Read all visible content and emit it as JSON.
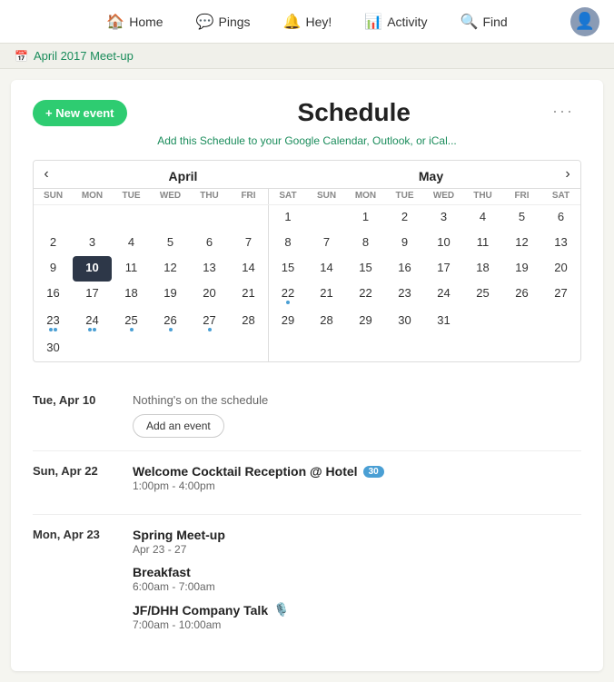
{
  "nav": {
    "items": [
      {
        "id": "home",
        "label": "Home",
        "icon": "🏠"
      },
      {
        "id": "pings",
        "label": "Pings",
        "icon": "💬"
      },
      {
        "id": "hey",
        "label": "Hey!",
        "icon": "🔔"
      },
      {
        "id": "activity",
        "label": "Activity",
        "icon": "📊"
      },
      {
        "id": "find",
        "label": "Find",
        "icon": "🔍"
      }
    ]
  },
  "breadcrumb": {
    "icon": "📅",
    "link_text": "April 2017 Meet-up"
  },
  "schedule": {
    "title": "Schedule",
    "new_event_label": "+ New event",
    "gcal_link_text": "Add this Schedule to your Google Calendar, Outlook, or iCal...",
    "more_label": "···"
  },
  "calendar": {
    "prev_label": "‹",
    "next_label": "›",
    "month1": {
      "name": "April",
      "day_headers": [
        "SUN",
        "MON",
        "TUE",
        "WED",
        "THU",
        "FRI",
        "SAT"
      ],
      "weeks": [
        [
          null,
          null,
          null,
          null,
          null,
          null,
          "1"
        ],
        [
          "2",
          "3",
          "4",
          "5",
          "6",
          "7",
          "8"
        ],
        [
          "9",
          {
            "val": "10",
            "today": true
          },
          "11",
          "12",
          "13",
          "14",
          "15"
        ],
        [
          "16",
          "17",
          "18",
          "19",
          "20",
          "21",
          "22"
        ],
        [
          "23",
          "24",
          "25",
          "26",
          "27",
          "28",
          "29"
        ],
        [
          "30",
          null,
          null,
          null,
          null,
          null,
          null
        ]
      ],
      "dotDays": {
        "22": [
          "blue"
        ],
        "23": [
          "blue",
          "blue"
        ],
        "24": [
          "blue",
          "blue"
        ],
        "25": [
          "blue"
        ],
        "26": [
          "blue"
        ],
        "27": [
          "blue"
        ]
      }
    },
    "month2": {
      "name": "May",
      "day_headers": [
        "SUN",
        "MON",
        "TUE",
        "WED",
        "THU",
        "FRI",
        "SAT"
      ],
      "weeks": [
        [
          null,
          "1",
          "2",
          "3",
          "4",
          "5",
          "6"
        ],
        [
          "7",
          "8",
          "9",
          "10",
          "11",
          "12",
          "13"
        ],
        [
          "14",
          "15",
          "16",
          "17",
          "18",
          "19",
          "20"
        ],
        [
          "21",
          "22",
          "23",
          "24",
          "25",
          "26",
          "27"
        ],
        [
          "28",
          "29",
          "30",
          "31",
          null,
          null,
          null
        ]
      ]
    }
  },
  "events": [
    {
      "date_label": "Tue, Apr 10",
      "items": [],
      "nothing_text": "Nothing's on the schedule",
      "add_label": "Add an event"
    },
    {
      "date_label": "Sun, Apr 22",
      "items": [
        {
          "title": "Welcome Cocktail Reception @ Hotel",
          "badge": "30",
          "time": "1:00pm - 4:00pm"
        }
      ]
    },
    {
      "date_label": "Mon, Apr 23",
      "items": [
        {
          "title": "Spring Meet-up",
          "sub": "Apr 23 - 27",
          "time": null
        },
        {
          "title": "Breakfast",
          "time": "6:00am - 7:00am"
        },
        {
          "title": "JF/DHH Company Talk",
          "icon": "🎙️",
          "time": "7:00am - 10:00am"
        }
      ]
    }
  ]
}
